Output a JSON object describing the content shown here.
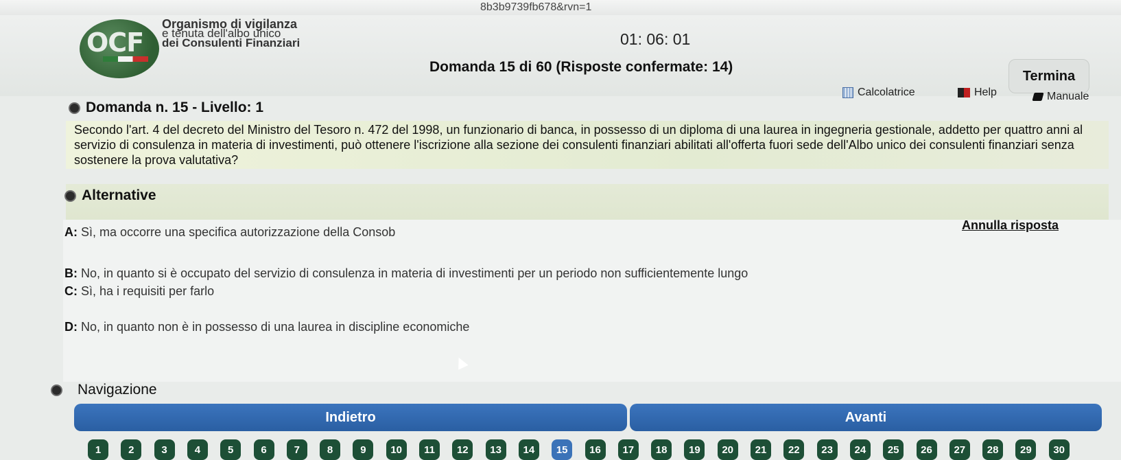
{
  "browser": {
    "url_fragment": "8b3b9739fb678&rvn=1"
  },
  "header": {
    "logo_text": "OCF",
    "org_line1": "Organismo di vigilanza",
    "org_line2": "e tenuta dell'albo unico",
    "org_line3": "dei Consulenti Finanziari",
    "timer": "01: 06: 01",
    "question_counter": "Domanda 15 di 60 (Risposte confermate: 14)",
    "termina_label": "Termina"
  },
  "tools": {
    "calculator": "Calcolatrice",
    "help": "Help",
    "manual": "Manuale"
  },
  "question": {
    "heading": "Domanda n. 15 - Livello: 1",
    "text": "Secondo l'art. 4 del decreto del Ministro del Tesoro n. 472 del 1998, un funzionario di banca, in possesso di un diploma di una laurea in ingegneria gestionale, addetto per quattro anni al servizio di consulenza in materia di investimenti, può ottenere l'iscrizione alla sezione dei consulenti finanziari abilitati all'offerta fuori sede dell'Albo unico dei consulenti finanziari senza sostenere la prova valutativa?"
  },
  "alternatives": {
    "heading": "Alternative",
    "annulla": "Annulla risposta",
    "items": [
      {
        "key": "A:",
        "text": " Sì, ma occorre una specifica autorizzazione della Consob"
      },
      {
        "key": "B:",
        "text": " No, in quanto si è occupato del servizio di consulenza in materia di investimenti per un periodo non sufficientemente lungo"
      },
      {
        "key": "C:",
        "text": " Sì, ha i requisiti per farlo"
      },
      {
        "key": "D:",
        "text": " No, in quanto non è in possesso di una laurea in discipline economiche"
      }
    ]
  },
  "navigation": {
    "heading": "Navigazione",
    "back": "Indietro",
    "forward": "Avanti",
    "pages": [
      "1",
      "2",
      "3",
      "4",
      "5",
      "6",
      "7",
      "8",
      "9",
      "10",
      "11",
      "12",
      "13",
      "14",
      "15",
      "16",
      "17",
      "18",
      "19",
      "20",
      "21",
      "22",
      "23",
      "24",
      "25",
      "26",
      "27",
      "28",
      "29",
      "30"
    ],
    "current_page": "15"
  }
}
